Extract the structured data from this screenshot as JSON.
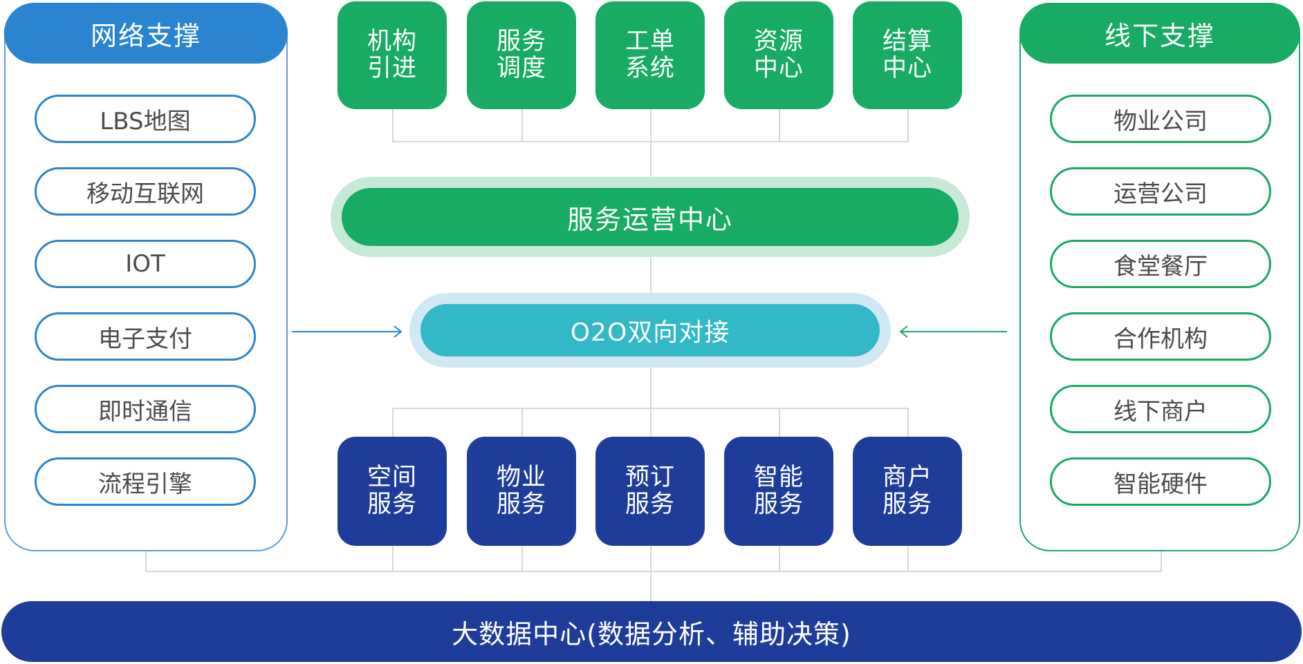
{
  "left_panel": {
    "title": "网络支撑",
    "items": [
      "LBS地图",
      "移动互联网",
      "IOT",
      "电子支付",
      "即时通信",
      "流程引擎"
    ]
  },
  "right_panel": {
    "title": "线下支撑",
    "items": [
      "物业公司",
      "运营公司",
      "食堂餐厅",
      "合作机构",
      "线下商户",
      "智能硬件"
    ]
  },
  "top_tiles": [
    {
      "line1": "机构",
      "line2": "引进"
    },
    {
      "line1": "服务",
      "line2": "调度"
    },
    {
      "line1": "工单",
      "line2": "系统"
    },
    {
      "line1": "资源",
      "line2": "中心"
    },
    {
      "line1": "结算",
      "line2": "中心"
    }
  ],
  "service_center": "服务运营中心",
  "o2o": "O2O双向对接",
  "bottom_tiles": [
    {
      "line1": "空间",
      "line2": "服务"
    },
    {
      "line1": "物业",
      "line2": "服务"
    },
    {
      "line1": "预订",
      "line2": "服务"
    },
    {
      "line1": "智能",
      "line2": "服务"
    },
    {
      "line1": "商户",
      "line2": "服务"
    }
  ],
  "big_data": "大数据中心(数据分析、辅助决策)",
  "colors": {
    "blue_header": "#2a84cf",
    "green": "#17ab64",
    "navy": "#1e3d9a",
    "teal": "#33b8c8"
  }
}
